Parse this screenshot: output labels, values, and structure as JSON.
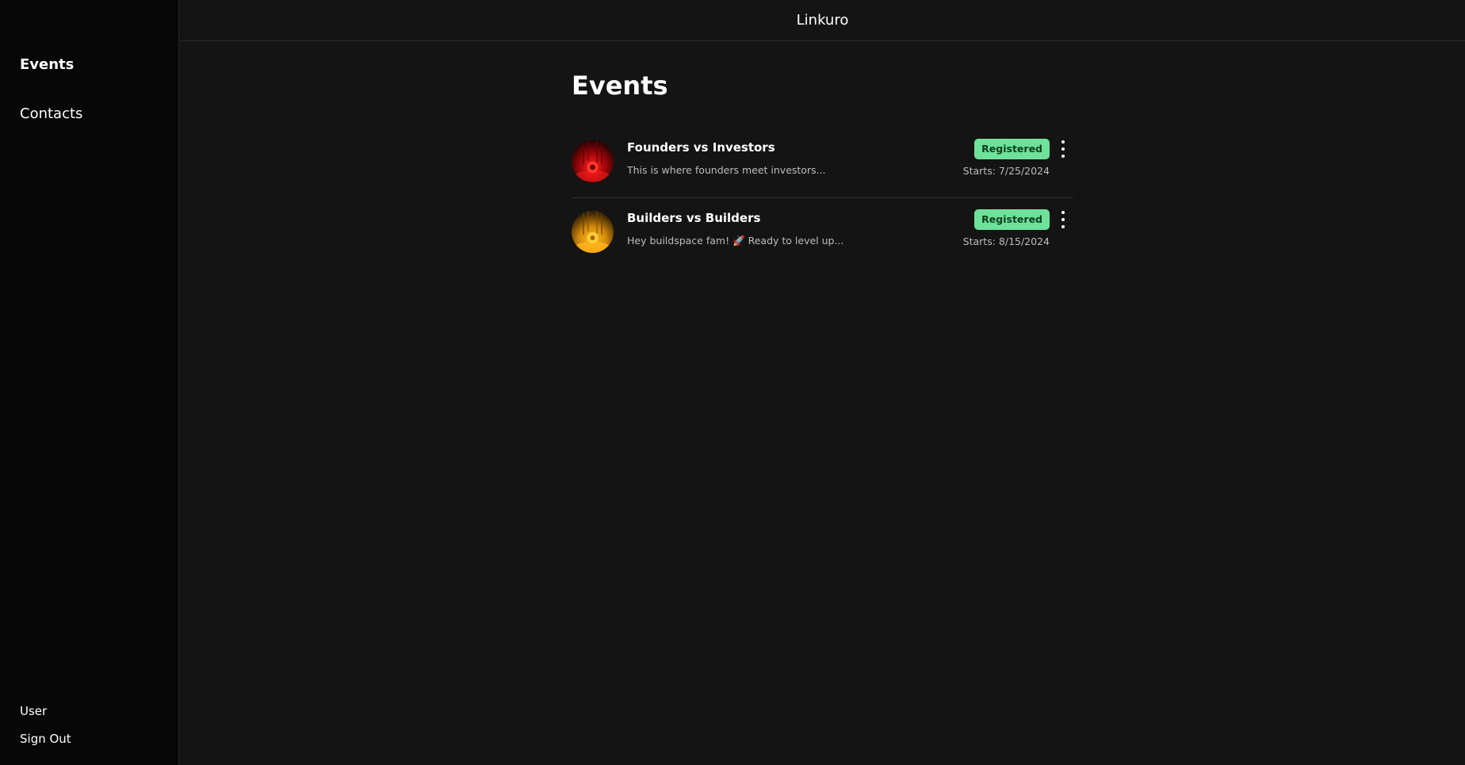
{
  "app": {
    "brand": "Linkuro"
  },
  "sidebar": {
    "items": [
      {
        "label": "Events",
        "active": true
      },
      {
        "label": "Contacts",
        "active": false
      }
    ],
    "bottom": {
      "user_label": "User",
      "signout_label": "Sign Out"
    }
  },
  "main": {
    "title": "Events",
    "events": [
      {
        "title": "Founders vs Investors",
        "description": "This is where founders meet investors...",
        "status": "Registered",
        "starts": "Starts: 7/25/2024",
        "thumb_color": "#d90e14"
      },
      {
        "title": "Builders vs Builders",
        "description": "Hey buildspace fam! 🚀 Ready to level up...",
        "status": "Registered",
        "starts": "Starts: 8/15/2024",
        "thumb_color": "#f2a614"
      }
    ]
  },
  "colors": {
    "background": "#141414",
    "sidebar": "#070707",
    "badge_bg": "#6ee29a",
    "badge_text": "#0b3d1f"
  }
}
